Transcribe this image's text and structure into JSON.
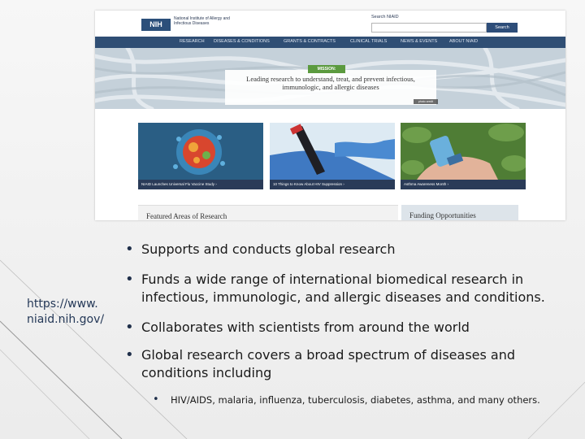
{
  "screenshot": {
    "org_logo": "NIH",
    "institute_name": "National Institute of Allergy and Infectious Diseases",
    "search_label": "Search NIAID",
    "search_button": "Search",
    "nav": [
      "RESEARCH",
      "DISEASES & CONDITIONS",
      "GRANTS & CONTRACTS",
      "CLINICAL TRIALS",
      "NEWS & EVENTS",
      "ABOUT NIAID"
    ],
    "mission_tag": "MISSION:",
    "mission_text": "Leading research to understand, treat, and prevent infectious, immunologic, and allergic diseases",
    "hero_credit": "photo credit",
    "cards": [
      {
        "caption": "NIAID Launches Universal Flu Vaccine Study ›"
      },
      {
        "caption": "10 Things to Know About HIV Suppression ›"
      },
      {
        "caption": "Asthma Awareness Month ›"
      }
    ],
    "featured_title": "Featured Areas of Research",
    "funding_title": "Funding Opportunities"
  },
  "url": "https://www.niaid.nih.gov/",
  "url_lines": [
    "https://www.",
    "niaid.nih.gov/"
  ],
  "bullets": [
    "Supports and conducts global research",
    "Funds a wide range of international biomedical research in infectious, immunologic, and allergic diseases and conditions.",
    "Collaborates with scientists from around the world",
    "Global research covers a broad spectrum of diseases and conditions including"
  ],
  "sub_bullets": [
    "HIV/AIDS, malaria, influenza, tuberculosis, diabetes, asthma, and many others."
  ],
  "colors": {
    "nav": "#2f4e74",
    "accent": "#5b9a3f",
    "text": "#1a1a1a",
    "link": "#243857"
  }
}
